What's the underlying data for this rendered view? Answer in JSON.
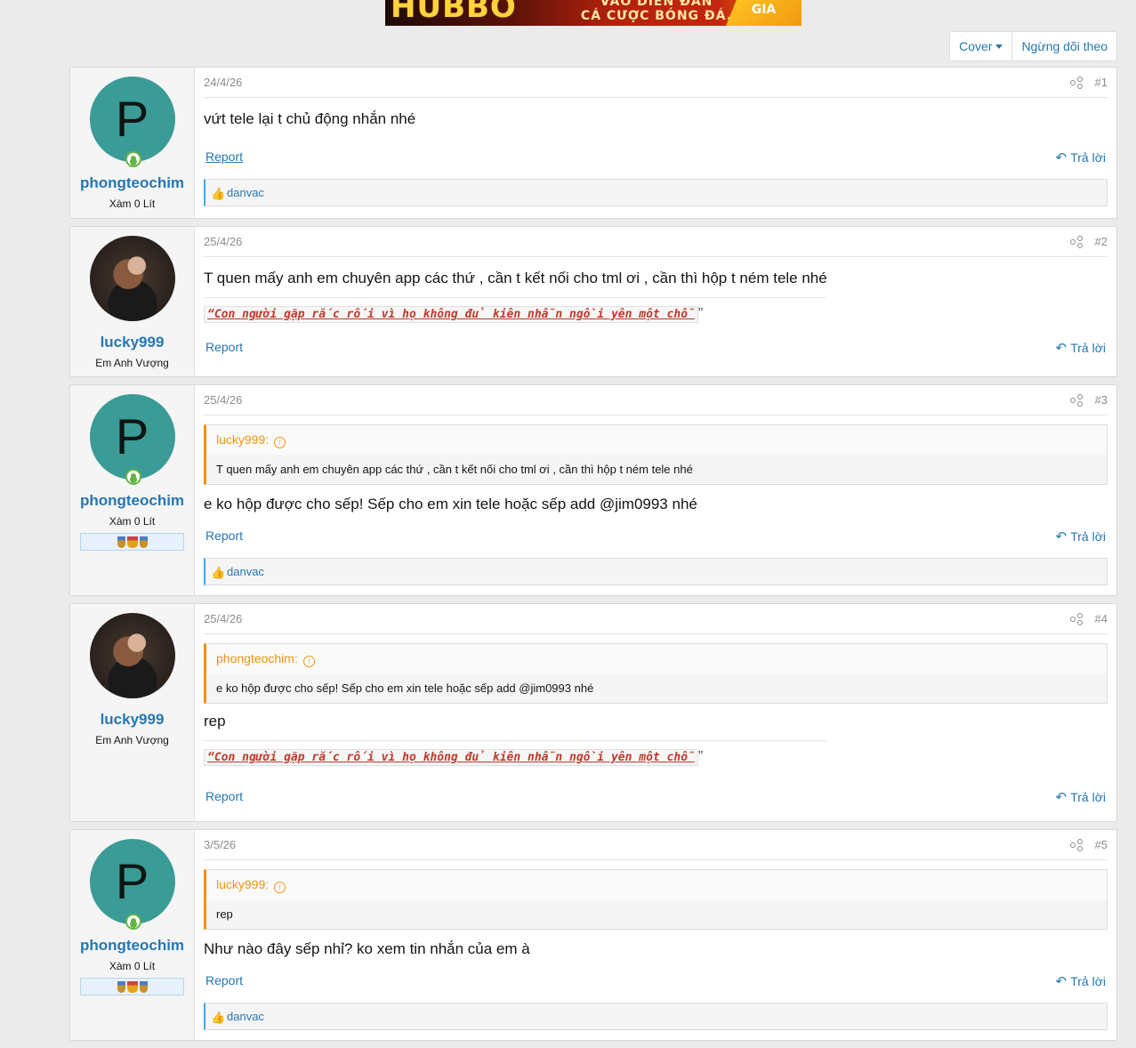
{
  "banner": {
    "brand": "HUBBO",
    "slogan_line1": "VÀO DIỄN ĐÀN",
    "slogan_line2": "CÁ CƯỢC BÓNG ĐÁ.",
    "cta": "GIA"
  },
  "toolbar": {
    "cover_label": "Cover",
    "unfollow_label": "Ngừng dõi theo"
  },
  "common": {
    "report_label": "Report",
    "reply_label": "Trả lời"
  },
  "posts": [
    {
      "user": {
        "name": "phongteochim",
        "title": "Xàm 0 Lít",
        "avatar_letter": "P"
      },
      "date": "24/4/26",
      "number": "#1",
      "body": "vứt tele lại t chủ động nhắn nhé",
      "reaction_user": "danvac"
    },
    {
      "user": {
        "name": "lucky999",
        "title": "Em Anh Vượng"
      },
      "date": "25/4/26",
      "number": "#2",
      "body": "T quen mấy anh em chuyên app các thứ , cần t kết nối cho tml ơi , cần thì hộp t ném tele nhé",
      "signature": "“Con người gặp rắc rối vì họ không đủ kiên nhẫn ngồi yên một chỗ",
      "signature_tail": "”"
    },
    {
      "user": {
        "name": "phongteochim",
        "title": "Xàm 0 Lít",
        "avatar_letter": "P"
      },
      "date": "25/4/26",
      "number": "#3",
      "quote_author": "lucky999:",
      "quote_text": "T quen mấy anh em chuyên app các thứ , cần t kết nối cho tml ơi , cần thì hộp t ném tele nhé",
      "body": "e ko hộp được cho sếp! Sếp cho em xin tele hoặc sếp add @jim0993 nhé",
      "reaction_user": "danvac"
    },
    {
      "user": {
        "name": "lucky999",
        "title": "Em Anh Vượng"
      },
      "date": "25/4/26",
      "number": "#4",
      "quote_author": "phongteochim:",
      "quote_text": "e ko hộp được cho sếp! Sếp cho em xin tele hoặc sếp add @jim0993 nhé",
      "body": "rep",
      "signature": "“Con người gặp rắc rối vì họ không đủ kiên nhẫn ngồi yên một chỗ",
      "signature_tail": "”"
    },
    {
      "user": {
        "name": "phongteochim",
        "title": "Xàm 0 Lít",
        "avatar_letter": "P"
      },
      "date": "3/5/26",
      "number": "#5",
      "quote_author": "lucky999:",
      "quote_text": "rep",
      "body": "Như nào đây sếp nhỉ? ko xem tin nhắn của em à",
      "reaction_user": "danvac"
    }
  ]
}
